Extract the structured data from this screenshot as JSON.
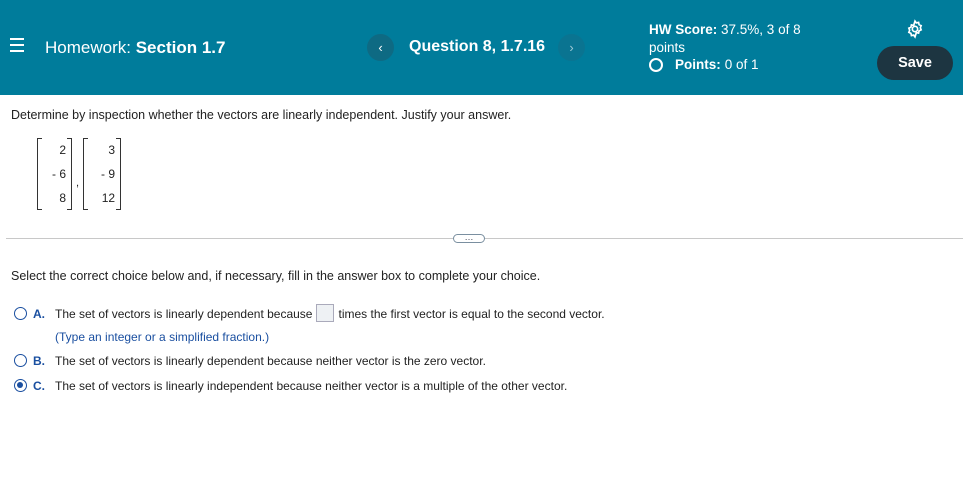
{
  "header": {
    "homework_label": "Homework:",
    "section_label": "Section 1.7",
    "question_label": "Question 8, 1.7.16",
    "prev_icon": "‹",
    "next_icon": "›",
    "score_label": "HW Score:",
    "score_value": "37.5%, 3 of 8",
    "score_unit": "points",
    "points_label": "Points:",
    "points_value": "0 of 1",
    "save_label": "Save",
    "colors": {
      "bar": "#007c9b",
      "save": "#1d3541"
    }
  },
  "question": {
    "prompt": "Determine by inspection whether the vectors are linearly independent. Justify your answer.",
    "vector1": [
      "2",
      "- 6",
      "8"
    ],
    "vector2": [
      "3",
      "- 9",
      "12"
    ],
    "separator": ",",
    "more_label": "…",
    "instruction": "Select the correct choice below and, if necessary, fill in the answer box to complete your choice."
  },
  "choices": {
    "a": {
      "letter": "A.",
      "text_before": "The set of vectors is linearly dependent because",
      "text_after": "times the first vector is equal to the second vector.",
      "hint": "(Type an integer or a simplified fraction.)"
    },
    "b": {
      "letter": "B.",
      "text": "The set of vectors is linearly dependent because neither vector is the zero vector."
    },
    "c": {
      "letter": "C.",
      "text": "The set of vectors is linearly independent because neither vector is a multiple of the other vector."
    },
    "selected": "C"
  }
}
